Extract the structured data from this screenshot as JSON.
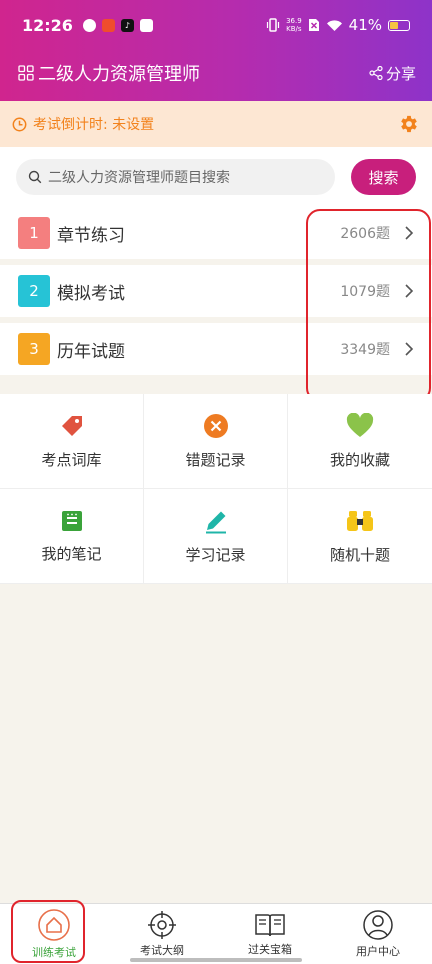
{
  "status_bar": {
    "time": "12:26",
    "net_speed_value": "36.9",
    "net_speed_unit": "KB/s",
    "battery": "41%"
  },
  "app_bar": {
    "title": "二级人力资源管理师",
    "share_label": "分享"
  },
  "countdown": {
    "text": "考试倒计时: 未设置"
  },
  "search": {
    "placeholder": "二级人力资源管理师题目搜索",
    "button_label": "搜索"
  },
  "practice_list": [
    {
      "number": "1",
      "label": "章节练习",
      "count": "2606题",
      "color": "#f47f7f"
    },
    {
      "number": "2",
      "label": "模拟考试",
      "count": "1079题",
      "color": "#26c3d6"
    },
    {
      "number": "3",
      "label": "历年试题",
      "count": "3349题",
      "color": "#f5a623"
    }
  ],
  "tools": [
    {
      "label": "考点词库",
      "icon": "tag-icon",
      "color": "#e0533f"
    },
    {
      "label": "错题记录",
      "icon": "close-circle-icon",
      "color": "#ee7b22"
    },
    {
      "label": "我的收藏",
      "icon": "heart-icon",
      "color": "#8bc34a"
    },
    {
      "label": "我的笔记",
      "icon": "note-icon",
      "color": "#3aa33a"
    },
    {
      "label": "学习记录",
      "icon": "pencil-icon",
      "color": "#1fb5a8"
    },
    {
      "label": "随机十题",
      "icon": "binoculars-icon",
      "color": "#f5c518"
    }
  ],
  "bottom_nav": [
    {
      "label": "训练考试",
      "icon": "home-icon",
      "active": true
    },
    {
      "label": "考试大纲",
      "icon": "target-icon",
      "active": false
    },
    {
      "label": "过关宝箱",
      "icon": "book-icon",
      "active": false
    },
    {
      "label": "用户中心",
      "icon": "user-icon",
      "active": false
    }
  ],
  "colors": {
    "header_gradient_start": "#d0258e",
    "header_gradient_end": "#8e33c9",
    "accent": "#c81f7c",
    "countdown_text": "#f2821c",
    "active_nav": "#3aa33a",
    "annotation_red": "#e0242c"
  }
}
